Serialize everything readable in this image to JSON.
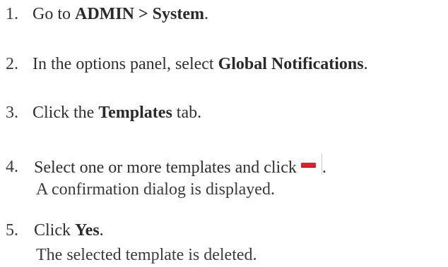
{
  "steps": [
    {
      "number": "1.",
      "prefix": "Go to ",
      "bold": "ADMIN > System",
      "suffix": "."
    },
    {
      "number": "2.",
      "prefix": "In the options panel, select ",
      "bold": "Global Notifications",
      "suffix": "."
    },
    {
      "number": "3.",
      "prefix": "Click the ",
      "bold": "Templates",
      "suffix": " tab."
    },
    {
      "number": "4.",
      "prefix": "Select one or more templates and click",
      "icon": "remove-icon",
      "suffix": ".",
      "result": "A confirmation dialog is displayed."
    },
    {
      "number": "5.",
      "prefix": "Click ",
      "bold": "Yes",
      "suffix": ".",
      "result": "The selected template is deleted."
    }
  ],
  "colors": {
    "text": "#2f2f2f",
    "remove_icon": "#e0202a"
  }
}
